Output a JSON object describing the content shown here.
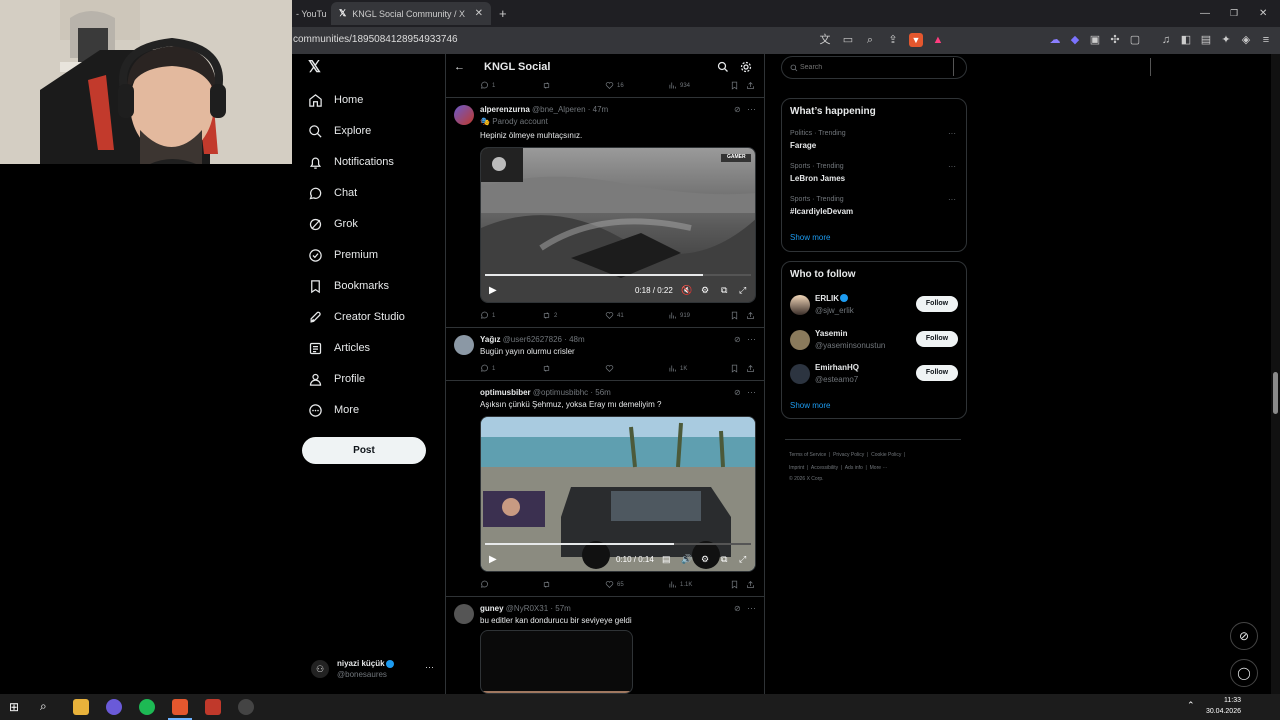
{
  "browser": {
    "tab_prev": "- YouTu",
    "tab_active": "KNGL Social Community / X",
    "url": "communities/1895084128954933746"
  },
  "nav": {
    "items": [
      "Home",
      "Explore",
      "Notifications",
      "Chat",
      "Grok",
      "Premium",
      "Bookmarks",
      "Creator Studio",
      "Articles",
      "Profile",
      "More"
    ],
    "post_label": "Post",
    "account_name": "niyazi küçük",
    "account_handle": "@bonesaures"
  },
  "header": {
    "title": "KNGL Social"
  },
  "top_actions": {
    "like": "16",
    "views": "934"
  },
  "tweets": [
    {
      "name": "alperenzurna",
      "handle": "@bne_Alperen · 47m",
      "label": "Parody account",
      "text": "Hepiniz ölmeye muhtaçsınız.",
      "time": "0:18 / 0:22",
      "reply": "1",
      "retweet": "2",
      "like": "41",
      "views": "919",
      "media_logo": "GAMER"
    },
    {
      "name": "Yağız",
      "handle": "@user62627826 · 48m",
      "text": "Bugün yayın olurmu crisler",
      "reply": "1",
      "views": "1K"
    },
    {
      "name": "optimusbiber",
      "handle": "@optimusbibhc · 56m",
      "text": "Aşıksın çünkü Şehmuz, yoksa Eray mı demeliyim ?",
      "time": "0:10 / 0:14",
      "like": "65",
      "views": "1.1K"
    },
    {
      "name": "guney",
      "handle": "@NyR0X31 · 57m",
      "text": "bu editler kan dondurucu bir seviyeye geldi"
    }
  ],
  "right": {
    "search_placeholder": "Search",
    "happening_title": "What’s happening",
    "trends": [
      {
        "meta": "Politics · Trending",
        "name": "Farage"
      },
      {
        "meta": "Sports · Trending",
        "name": "LeBron James"
      },
      {
        "meta": "Sports · Trending",
        "name": "#IcardiyleDevam"
      }
    ],
    "show_more": "Show more",
    "follow_title": "Who to follow",
    "follow": [
      {
        "name": "ERLIK",
        "handle": "@sjw_erlik"
      },
      {
        "name": "Yasemin",
        "handle": "@yaseminsonustun"
      },
      {
        "name": "EmirhanHQ",
        "handle": "@esteamo7"
      }
    ],
    "follow_label": "Follow",
    "footer_line1": [
      "Terms of Service",
      "Privacy Policy",
      "Cookie Policy"
    ],
    "footer_line2": [
      "Imprint",
      "Accessibility",
      "Ads info",
      "More ···"
    ],
    "copyright": "© 2026 X Corp."
  },
  "taskbar": {
    "time": "11:33",
    "date": "30.04.2026"
  },
  "colors": {
    "background": "#000000",
    "border": "#2f3336",
    "muted": "#71767b",
    "verified": "#1d9bf0"
  }
}
